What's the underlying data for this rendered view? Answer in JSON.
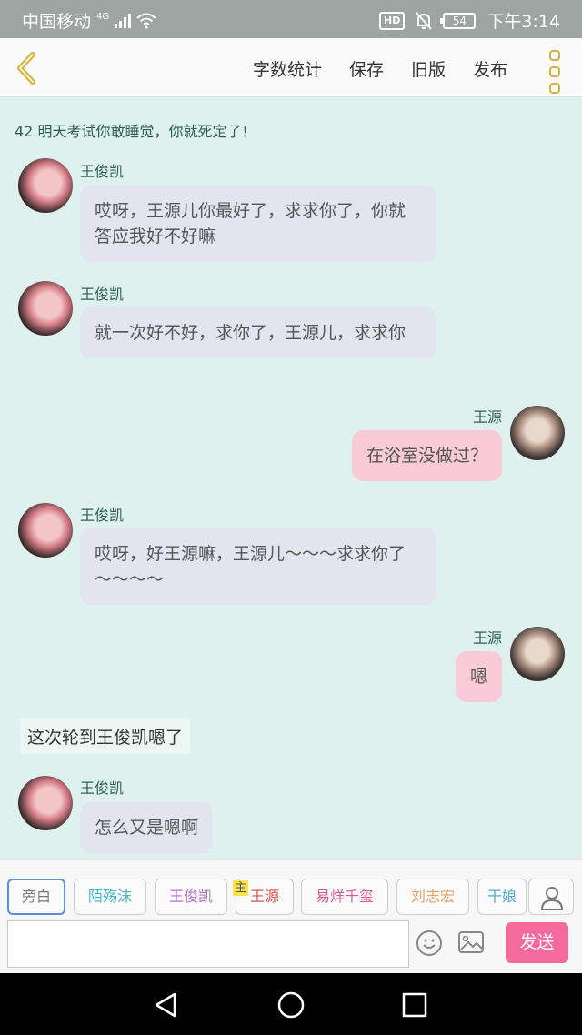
{
  "status": {
    "carrier": "中国移动",
    "network": "4G",
    "hd": "HD",
    "battery": "54",
    "time": "下午3:14"
  },
  "header": {
    "menu": [
      "字数统计",
      "保存",
      "旧版",
      "发布"
    ]
  },
  "chat": {
    "title": "42 明天考试你敢睡觉，你就死定了！",
    "messages": [
      {
        "side": "left",
        "name": "王俊凯",
        "text": "哎呀，王源儿你最好了，求求你了，你就答应我好不好嘛"
      },
      {
        "side": "left",
        "name": "王俊凯",
        "text": "就一次好不好，求你了，王源儿，求求你"
      },
      {
        "side": "right",
        "name": "王源",
        "text": "在浴室没做过？"
      },
      {
        "side": "left",
        "name": "王俊凯",
        "text": "哎呀，好王源嘛，王源儿～～～求求你了～～～～"
      },
      {
        "side": "right",
        "name": "王源",
        "text": "嗯"
      },
      {
        "side": "narration",
        "text": "这次轮到王俊凯嗯了"
      },
      {
        "side": "left",
        "name": "王俊凯",
        "text": "怎么又是嗯啊"
      }
    ]
  },
  "characters": {
    "items": [
      {
        "label": "旁白",
        "color": "#777777"
      },
      {
        "label": "陌殇沫",
        "color": "#4bb3c4"
      },
      {
        "label": "王俊凯",
        "color": "#b276c8"
      },
      {
        "label": "王源",
        "color": "#d9534f"
      },
      {
        "label": "易烊千玺",
        "color": "#d45d8c"
      },
      {
        "label": "刘志宏",
        "color": "#e0a466"
      },
      {
        "label": "干娘",
        "color": "#4bb3c4"
      }
    ],
    "main_badge": "主"
  },
  "input": {
    "placeholder": "",
    "send_label": "发送"
  }
}
